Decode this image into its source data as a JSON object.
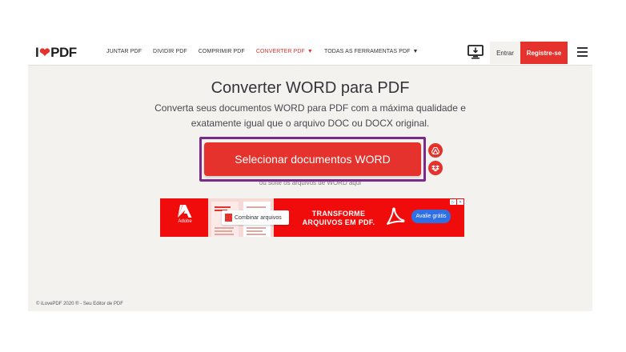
{
  "brand": {
    "logo_left": "I",
    "logo_right": "PDF",
    "accent": "#e5322d",
    "purple_outline": "#7c2a8a"
  },
  "nav": {
    "items": [
      {
        "label": "JUNTAR PDF",
        "active": false
      },
      {
        "label": "DIVIDIR PDF",
        "active": false
      },
      {
        "label": "COMPRIMIR PDF",
        "active": false
      },
      {
        "label": "CONVERTER PDF",
        "active": true
      },
      {
        "label": "TODAS AS FERRAMENTAS PDF",
        "active": false
      }
    ]
  },
  "header": {
    "login_label": "Entrar",
    "register_label": "Registre-se",
    "monitor_icon": "desktop-download-icon",
    "menu_icon": "hamburger-menu-icon"
  },
  "main": {
    "title": "Converter WORD para PDF",
    "subtitle": "Converta seus documentos WORD para PDF com a máxima qualidade e exatamente igual que o arquivo DOC ou DOCX original.",
    "select_button": "Selecionar documentos WORD",
    "drop_hint": "ou solte os arquivos de WORD aqui",
    "cloud_icons": [
      "google-drive-icon",
      "dropbox-icon"
    ]
  },
  "ad": {
    "brand": "Adobe",
    "tooltip": "Combinar arquivos",
    "headline_line1": "TRANSFORME",
    "headline_line2": "ARQUIVOS EM PDF.",
    "cta": "Avalie grátis"
  },
  "footer": {
    "copyright": "© iLovePDF 2020 ® - Seu Editor de PDF"
  }
}
